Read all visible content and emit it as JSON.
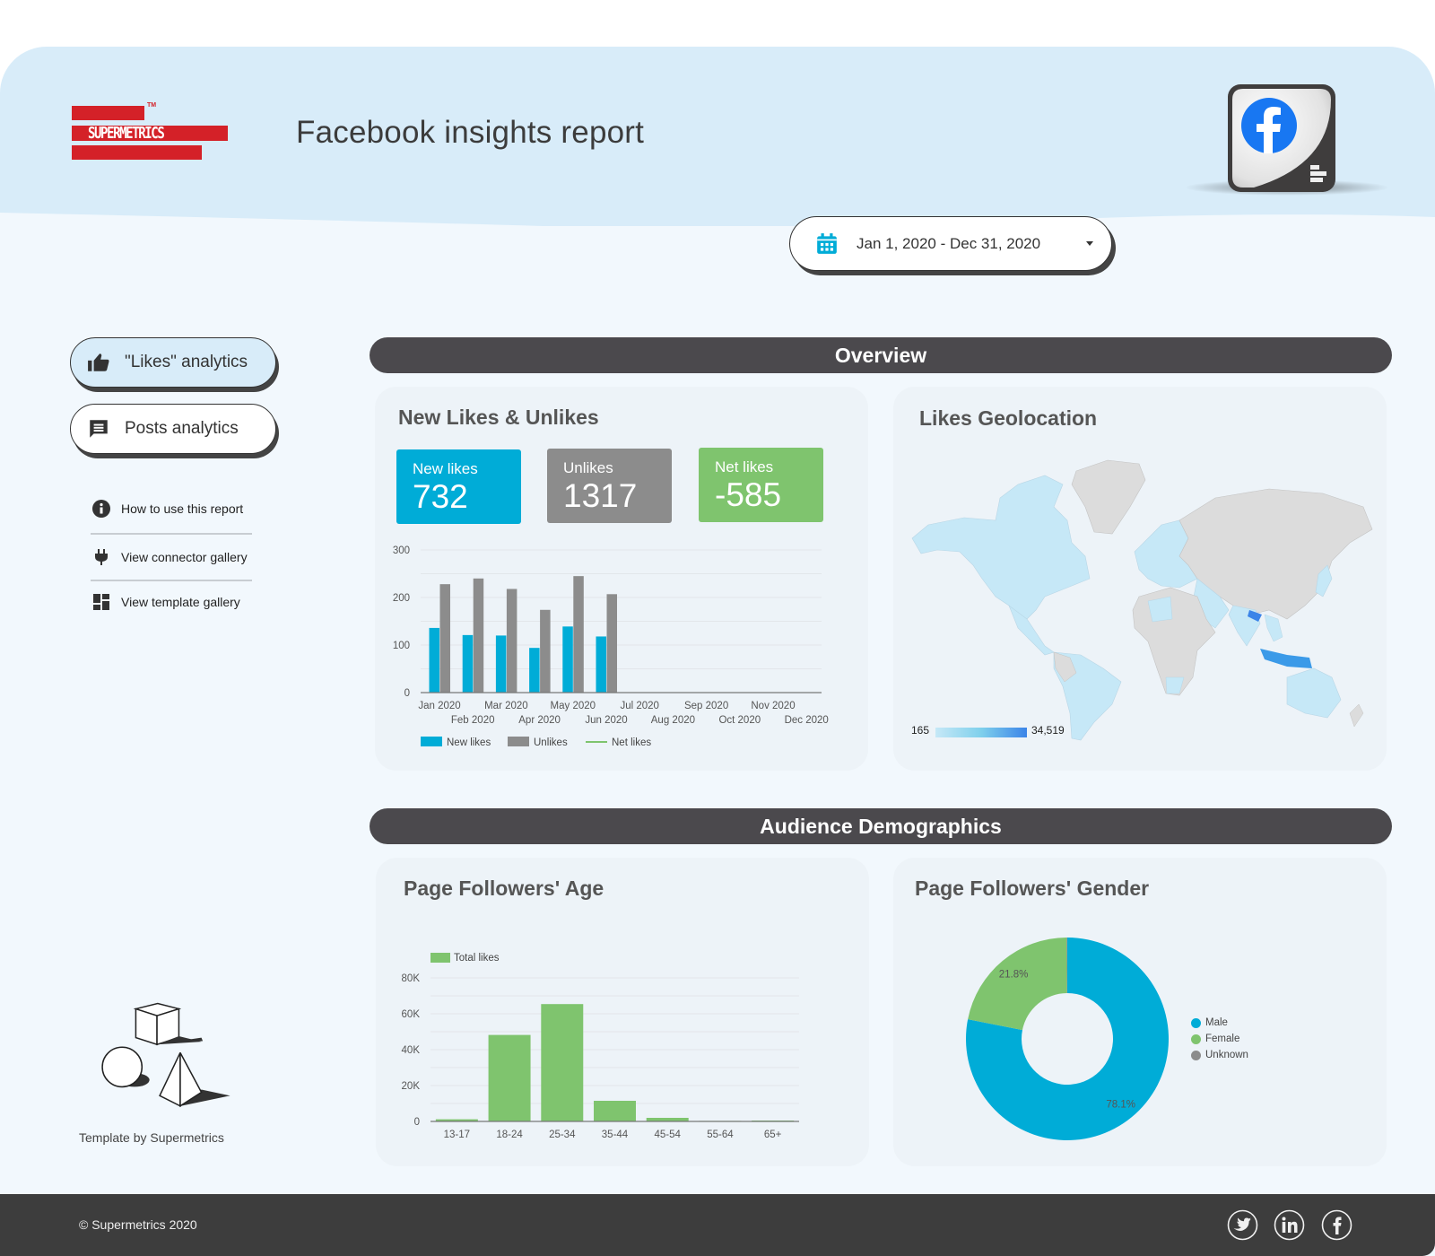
{
  "header": {
    "logo_text": "SUPERMETRICS",
    "logo_tm": "TM",
    "title": "Facebook insights report",
    "connector_icon": "facebook-connector-icon"
  },
  "date_range": {
    "icon": "calendar-icon",
    "value": "Jan 1, 2020 - Dec 31, 2020"
  },
  "sidebar": {
    "nav": [
      {
        "label": "\"Likes\" analytics",
        "icon": "thumbs-up-icon",
        "active": true
      },
      {
        "label": "Posts analytics",
        "icon": "chat-icon",
        "active": false
      }
    ],
    "links": [
      {
        "label": "How to use this report",
        "icon": "info-icon"
      },
      {
        "label": "View connector gallery",
        "icon": "plug-icon"
      },
      {
        "label": "View template gallery",
        "icon": "grid-icon"
      }
    ],
    "template_by": "Template by Supermetrics"
  },
  "sections": {
    "overview": "Overview",
    "demographics": "Audience Demographics"
  },
  "cards": {
    "likes_unlikes": {
      "title": "New Likes & Unlikes",
      "kpis": [
        {
          "label": "New likes",
          "value": "732",
          "color": "#00acd7"
        },
        {
          "label": "Unlikes",
          "value": "1317",
          "color": "#8c8c8c"
        },
        {
          "label": "Net likes",
          "value": "-585",
          "color": "#7fc46e"
        }
      ]
    },
    "geo": {
      "title": "Likes Geolocation",
      "scale_min": "165",
      "scale_max": "34,519"
    },
    "age": {
      "title": "Page Followers' Age"
    },
    "gender": {
      "title": "Page Followers' Gender"
    }
  },
  "chart_data": [
    {
      "type": "bar",
      "title": "New Likes & Unlikes",
      "categories": [
        "Jan 2020",
        "Feb 2020",
        "Mar 2020",
        "Apr 2020",
        "May 2020",
        "Jun 2020",
        "Jul 2020",
        "Aug 2020",
        "Sep 2020",
        "Oct 2020",
        "Nov 2020",
        "Dec 2020"
      ],
      "series": [
        {
          "name": "New likes",
          "color": "#00acd7",
          "values": [
            136,
            121,
            120,
            94,
            139,
            118,
            0,
            0,
            0,
            0,
            0,
            0
          ]
        },
        {
          "name": "Unlikes",
          "color": "#8c8c8c",
          "values": [
            228,
            240,
            218,
            174,
            245,
            207,
            0,
            0,
            0,
            0,
            0,
            0
          ]
        },
        {
          "name": "Net likes",
          "color": "#7fc46e",
          "type": "line",
          "values": []
        }
      ],
      "ylim": [
        0,
        300
      ],
      "yticks": [
        0,
        100,
        200,
        300
      ],
      "grid": true,
      "legend": "bottom-left"
    },
    {
      "type": "bar",
      "title": "Page Followers' Age",
      "categories": [
        "13-17",
        "18-24",
        "25-34",
        "35-44",
        "45-54",
        "55-64",
        "65+"
      ],
      "series": [
        {
          "name": "Total likes",
          "color": "#7fc46e",
          "values": [
            1200,
            48200,
            65400,
            11500,
            2000,
            300,
            500
          ]
        }
      ],
      "ylim": [
        0,
        80000
      ],
      "yticks": [
        0,
        20000,
        40000,
        60000,
        80000
      ],
      "ytick_labels": [
        "0",
        "20K",
        "40K",
        "60K",
        "80K"
      ],
      "grid": true,
      "legend": "top-left"
    },
    {
      "type": "pie",
      "title": "Page Followers' Gender",
      "donut": true,
      "slices": [
        {
          "label": "Male",
          "value": 78.1,
          "color": "#00acd7"
        },
        {
          "label": "Female",
          "value": 21.8,
          "color": "#7fc46e"
        },
        {
          "label": "Unknown",
          "value": 0.1,
          "color": "#8c8c8c"
        }
      ],
      "legend": "right"
    }
  ],
  "footer": {
    "copyright": "© Supermetrics 2020",
    "social": [
      "twitter-icon",
      "linkedin-icon",
      "facebook-icon"
    ]
  }
}
